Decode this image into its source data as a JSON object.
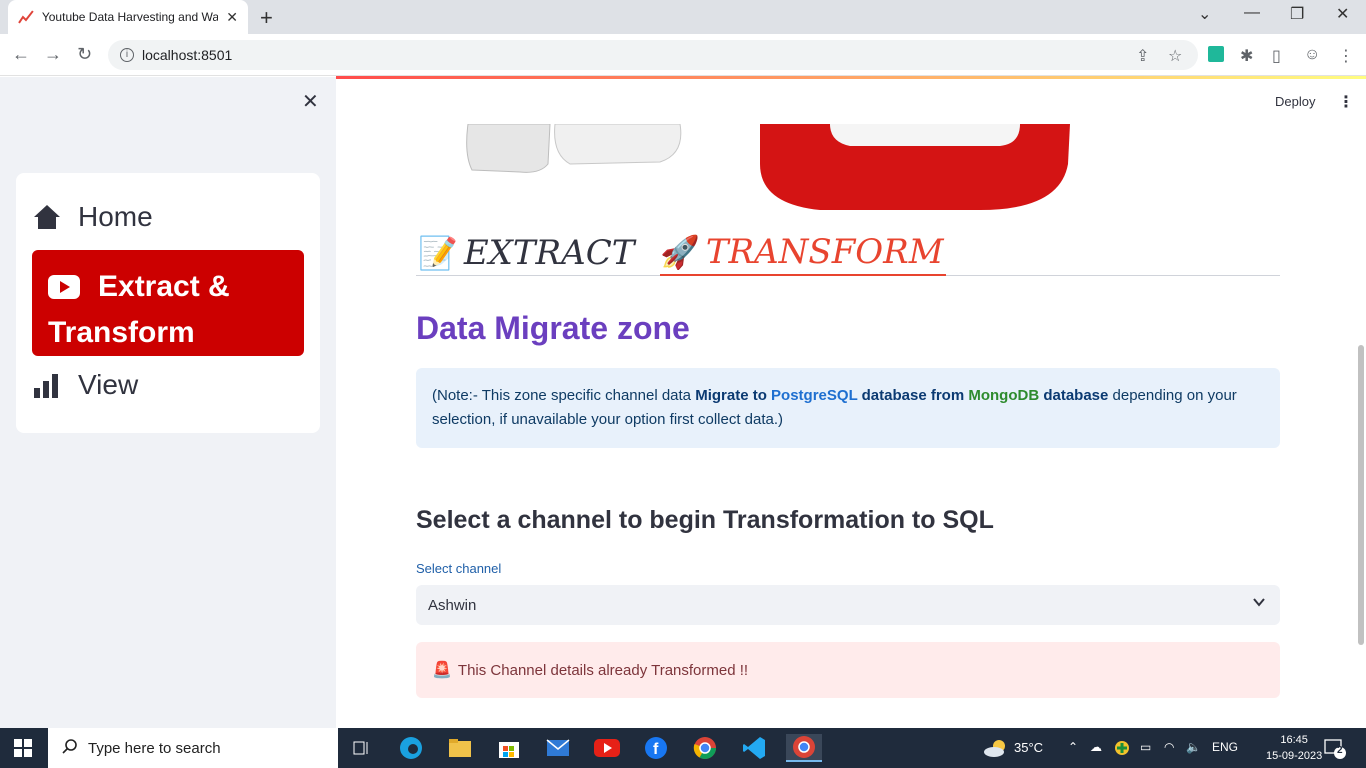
{
  "browser": {
    "tab_title": "Youtube Data Harvesting and Wa",
    "url": "localhost:8501"
  },
  "sidebar": {
    "items": [
      {
        "label": "Home",
        "icon": "house-icon"
      },
      {
        "label": "Extract & Transform",
        "icon": "youtube-icon",
        "active": true
      },
      {
        "label": "View",
        "icon": "bar-chart-icon"
      }
    ],
    "active_line1": "Extract &",
    "active_line2": "Transform"
  },
  "header": {
    "deploy_label": "Deploy"
  },
  "tabs": [
    {
      "emoji": "📝",
      "label": "EXTRACT"
    },
    {
      "emoji": "🚀",
      "label": "TRANSFORM",
      "active": true
    }
  ],
  "main": {
    "title": "Data Migrate zone",
    "note": {
      "p1": "(Note:- This zone specific channel data ",
      "b1": "Migrate to ",
      "pg": "PostgreSQL",
      "b2": " database from ",
      "mg": "MongoDB",
      "b3": " database",
      "p2": " depending on your selection, if unavailable your option first collect data.)"
    },
    "select_heading": "Select a channel to begin Transformation to SQL",
    "select_label": "Select channel",
    "select_value": "Ashwin",
    "alert_emoji": "🚨",
    "alert_text": "This Channel details already Transformed !!"
  },
  "taskbar": {
    "search_placeholder": "Type here to search",
    "weather": "35°C",
    "lang": "ENG",
    "time": "16:45",
    "date": "15-09-2023",
    "notifications": "2"
  },
  "colors": {
    "accent": "#cc0000",
    "title_purple": "#6b3fbf",
    "tab_active": "#e8442f"
  }
}
